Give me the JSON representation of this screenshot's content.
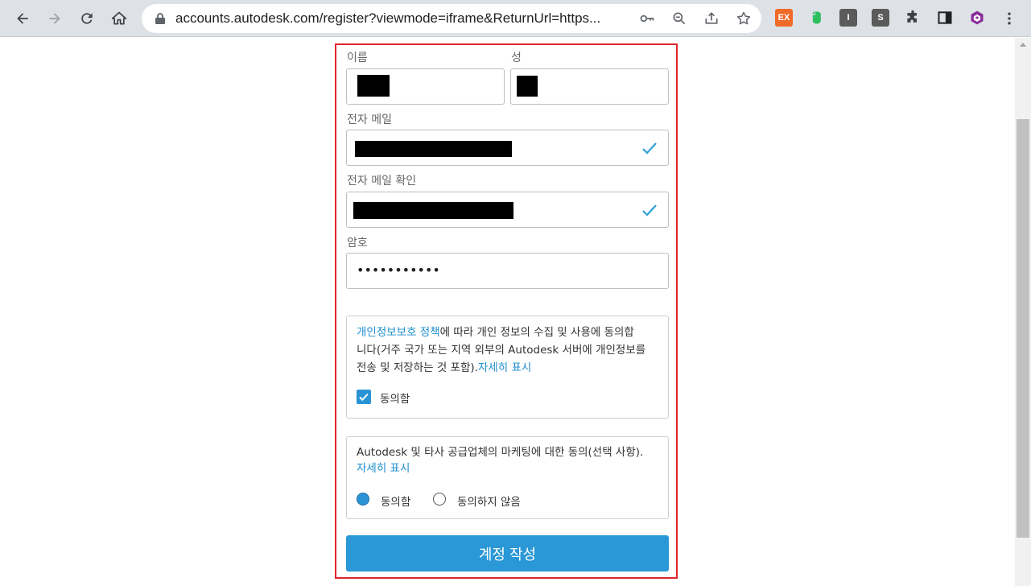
{
  "browser": {
    "url": "accounts.autodesk.com/register?viewmode=iframe&ReturnUrl=https...",
    "extensions": {
      "ex_label": "EX",
      "i_label": "I",
      "s_label": "S"
    }
  },
  "form": {
    "first_name_label": "이름",
    "last_name_label": "성",
    "email_label": "전자 메일",
    "email_confirm_label": "전자 메일 확인",
    "password_label": "암호",
    "password_value": "•••••••••••"
  },
  "privacy": {
    "link_text": "개인정보보호 정책",
    "text_part1": "에 따라 개인 정보의 수집 및 사용에 동의합",
    "text_line2": "니다(거주 국가 또는 지역 외부의 Autodesk 서버에 개인정보를",
    "text_line3": "전송 및 저장하는 것 포함).",
    "more_link": "자세히 표시",
    "agree_label": "동의함",
    "agree_checked": true
  },
  "marketing": {
    "text": "Autodesk 및 타사 공급업체의 마케팅에 대한 동의(선택 사항).",
    "more_link": "자세히 표시",
    "agree_label": "동의함",
    "disagree_label": "동의하지 않음",
    "selected": "agree"
  },
  "submit_label": "계정 작성",
  "colors": {
    "accent": "#2a97d6",
    "link": "#1f8fcf",
    "highlight_border": "#e2232a",
    "check": "#2f9fd8"
  }
}
